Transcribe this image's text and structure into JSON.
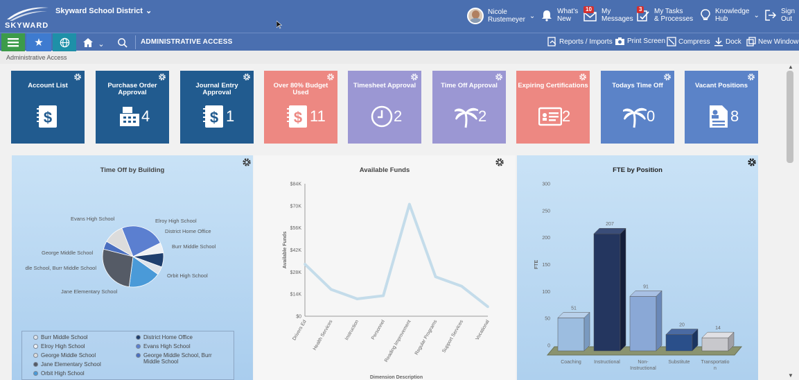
{
  "header": {
    "logo_text": "SKYWARD",
    "district": "Skyward School District",
    "user_name": "Nicole\nRustemeyer",
    "whats_new": "What's\nNew",
    "messages": "My\nMessages",
    "messages_count": "10",
    "tasks": "My Tasks\n& Processes",
    "tasks_count": "3",
    "knowledge": "Knowledge\nHub",
    "sign_out": "Sign\nOut"
  },
  "nav": {
    "title": "ADMINISTRATIVE ACCESS",
    "tools": [
      "Reports / Imports",
      "Print Screen",
      "Compress",
      "Dock",
      "New Window"
    ]
  },
  "breadcrumb": "Administrative Access",
  "tiles": [
    {
      "label": "Account List",
      "count": "",
      "color": "#215b8f",
      "icon": "ledger-dollar-icon"
    },
    {
      "label": "Purchase Order Approval",
      "count": "4",
      "color": "#215b8f",
      "icon": "cash-register-icon"
    },
    {
      "label": "Journal Entry Approval",
      "count": "1",
      "color": "#215b8f",
      "icon": "ledger-dollar-icon"
    },
    {
      "label": "Over 80% Budget Used",
      "count": "11",
      "color": "#ed8882",
      "icon": "ledger-dollar-icon"
    },
    {
      "label": "Timesheet Approval",
      "count": "2",
      "color": "#9b97d3",
      "icon": "clock-icon"
    },
    {
      "label": "Time Off Approval",
      "count": "2",
      "color": "#9b97d3",
      "icon": "palm-tree-icon"
    },
    {
      "label": "Expiring Certifications",
      "count": "2",
      "color": "#ed8882",
      "icon": "certificate-icon"
    },
    {
      "label": "Todays Time Off",
      "count": "0",
      "color": "#5b83c8",
      "icon": "palm-tree-icon"
    },
    {
      "label": "Vacant Positions",
      "count": "8",
      "color": "#5b83c8",
      "icon": "document-icon"
    }
  ],
  "colors": {
    "top_bar": "#4a6fb0",
    "nav_green": "#3c9b4a",
    "nav_blue": "#3e7bd0",
    "nav_teal": "#1e90a8"
  },
  "charts": {
    "time_off": {
      "title": "Time Off by Building",
      "slice_labels": [
        "Evans High School",
        "Elroy High School",
        "District Home Office",
        "Burr Middle School",
        "Orbit High School",
        "Jane Elementary School",
        "dle School, Burr Middle School",
        "George Middle School"
      ],
      "legend": [
        {
          "name": "Burr Middle School",
          "color": "#dde3ea"
        },
        {
          "name": "District Home Office",
          "color": "#1f3f6e"
        },
        {
          "name": "Elroy High School",
          "color": "#eef1f5"
        },
        {
          "name": "Evans High School",
          "color": "#5b7fd0"
        },
        {
          "name": "George Middle School",
          "color": "#dcdcdc"
        },
        {
          "name": "George Middle School, Burr Middle School",
          "color": "#4a6fc0"
        },
        {
          "name": "Jane Elementary School",
          "color": "#555b66"
        },
        {
          "name": "Orbit High School",
          "color": "#4a9ad8"
        }
      ]
    },
    "funds": {
      "title": "Available Funds",
      "ylabel": "Available Funds",
      "xlabel_partial": "Dimension Description",
      "yticks": [
        "$0",
        "$14K",
        "$28K",
        "$42K",
        "$56K",
        "$70K",
        "$84K"
      ]
    },
    "fte": {
      "title": "FTE by Position",
      "ylabel": "FTE",
      "yticks": [
        "0",
        "50",
        "100",
        "150",
        "200",
        "250",
        "300"
      ]
    }
  },
  "chart_data": [
    {
      "type": "pie",
      "title": "Time Off by Building",
      "categories": [
        "Evans High School",
        "Elroy High School",
        "District Home Office",
        "Burr Middle School",
        "Orbit High School",
        "Jane Elementary School",
        "George Middle School, Burr Middle School",
        "George Middle School"
      ],
      "values": [
        22,
        5,
        7,
        4,
        16,
        25,
        4,
        10
      ]
    },
    {
      "type": "line",
      "title": "Available Funds",
      "ylabel": "Available Funds",
      "categories": [
        "Drivers Ed",
        "Health Services",
        "Instruction",
        "Personnel",
        "Reading Improvement",
        "Regular Programs",
        "Support Services",
        "Vocational"
      ],
      "values": [
        33000,
        17000,
        11000,
        13000,
        71000,
        25000,
        19000,
        6000
      ],
      "ylim": [
        0,
        84000
      ]
    },
    {
      "type": "bar",
      "title": "FTE by Position",
      "ylabel": "FTE",
      "categories": [
        "Coaching",
        "Instructional",
        "Non-\nInstructional",
        "Substitute",
        "Transportatio\nn"
      ],
      "values": [
        51,
        207,
        91,
        20,
        14
      ],
      "ylim": [
        0,
        300
      ]
    }
  ]
}
